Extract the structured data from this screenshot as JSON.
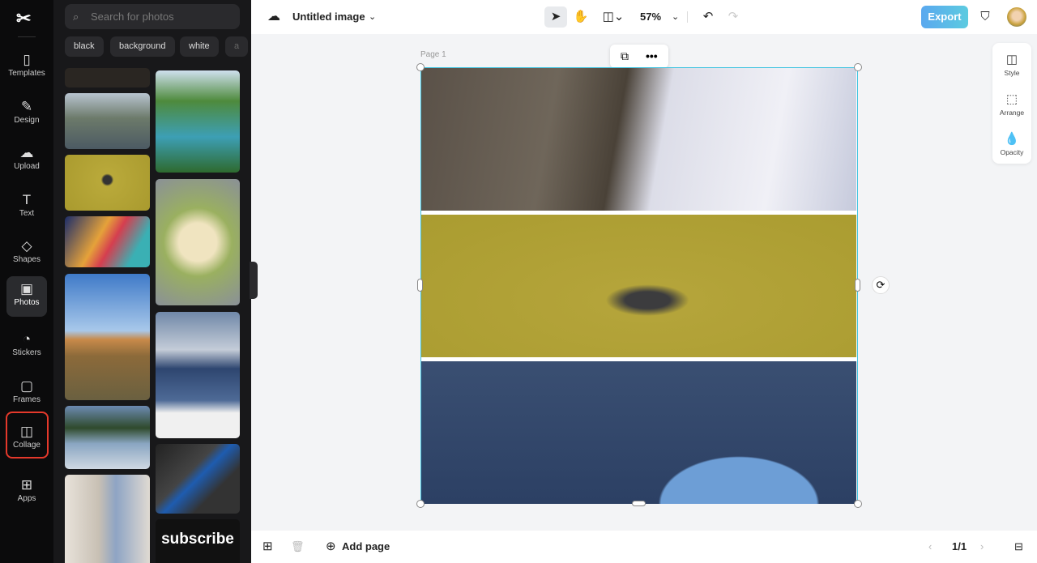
{
  "nav": {
    "items": [
      {
        "label": "Templates",
        "icon": "templates-icon"
      },
      {
        "label": "Design",
        "icon": "design-icon"
      },
      {
        "label": "Upload",
        "icon": "upload-icon"
      },
      {
        "label": "Text",
        "icon": "text-icon"
      },
      {
        "label": "Shapes",
        "icon": "shapes-icon"
      },
      {
        "label": "Photos",
        "icon": "photos-icon"
      },
      {
        "label": "Stickers",
        "icon": "stickers-icon"
      },
      {
        "label": "Frames",
        "icon": "frames-icon"
      },
      {
        "label": "Collage",
        "icon": "collage-icon"
      },
      {
        "label": "Apps",
        "icon": "apps-icon"
      }
    ]
  },
  "panel": {
    "search_placeholder": "Search for photos",
    "tags": [
      "black",
      "background",
      "white",
      "a"
    ],
    "thumb_text": "subscribe"
  },
  "top": {
    "title": "Untitled image",
    "zoom": "57%",
    "export": "Export"
  },
  "canvas": {
    "page_label": "Page 1"
  },
  "right": {
    "items": [
      "Style",
      "Arrange",
      "Opacity"
    ]
  },
  "bottom": {
    "add_page": "Add page",
    "page_count": "1/1"
  },
  "colors": {
    "accent": "#3ec3e0",
    "highlight": "#e5392b"
  }
}
